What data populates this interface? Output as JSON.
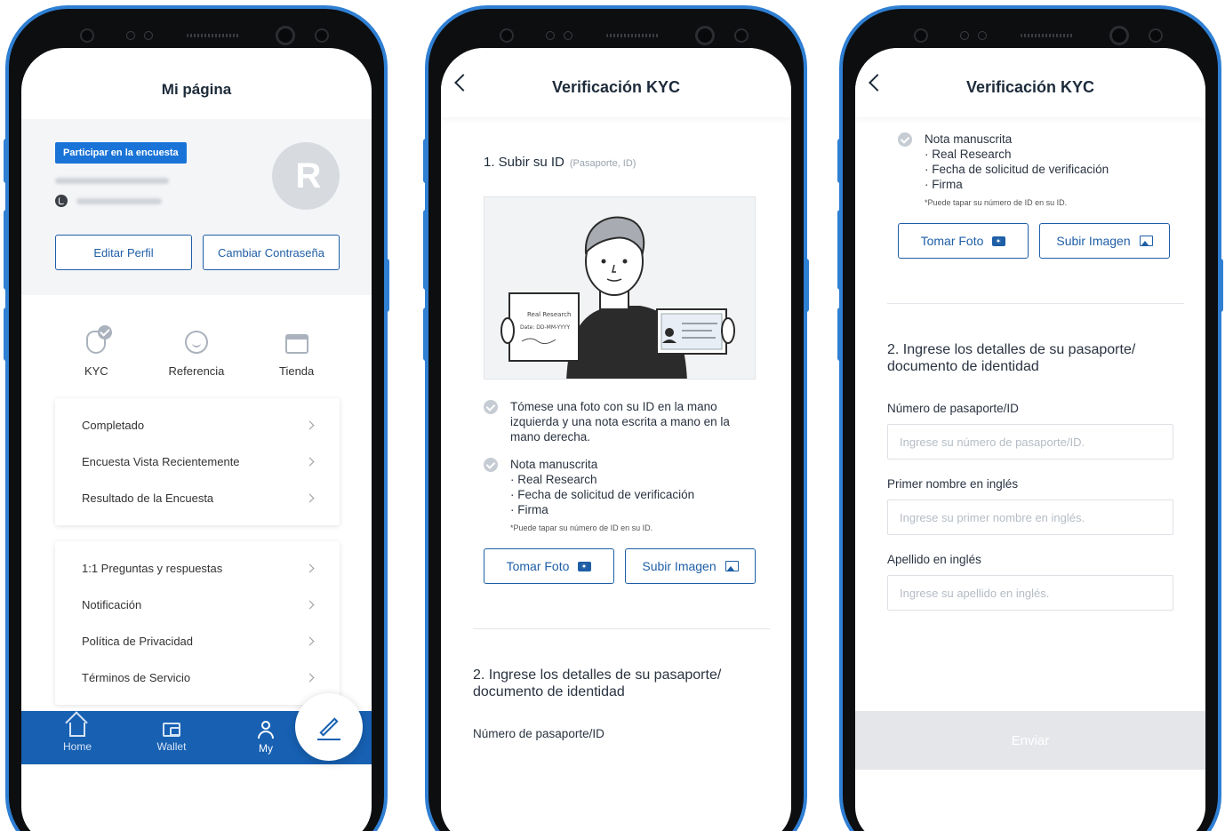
{
  "screen1": {
    "title": "Mi página",
    "survey_badge": "Participar en la encuesta",
    "avatar_text": "R",
    "edit_profile": "Editar Perfil",
    "change_password": "Cambiar Contraseña",
    "shortcuts": [
      {
        "label": "KYC",
        "icon": "shield-check-icon"
      },
      {
        "label": "Referencia",
        "icon": "smile-icon"
      },
      {
        "label": "Tienda",
        "icon": "store-icon"
      }
    ],
    "menu_group1": [
      "Completado",
      "Encuesta Vista Recientemente",
      "Resultado de la Encuesta"
    ],
    "menu_group2": [
      "1:1 Preguntas y respuestas",
      "Notificación",
      "Política de Privacidad",
      "Términos de Servicio"
    ],
    "tabs": [
      "Home",
      "Wallet",
      "My"
    ],
    "accent_color": "#1760b2"
  },
  "screen2": {
    "title": "Verificación KYC",
    "step1_title": "1. Subir su ID",
    "step1_sub": "(Pasaporte, ID)",
    "illus_note_line1": "Real Research",
    "illus_note_line2": "Date: DD-MM-YYYY",
    "bullet1": [
      "Tómese una foto con su ID en la mano",
      "izquierda y una nota escrita a mano en la",
      "mano derecha."
    ],
    "bullet2": [
      "Nota manuscrita",
      "· Real Research",
      "· Fecha de solicitud de verificación",
      "· Firma"
    ],
    "small_note": "*Puede tapar su número de ID en su ID.",
    "take_photo": "Tomar Foto",
    "upload_image": "Subir Imagen",
    "step2_title": [
      "2. Ingrese los detalles de su pasaporte/",
      "documento de identidad"
    ],
    "passport_label": "Número de pasaporte/ID"
  },
  "screen3": {
    "title": "Verificación KYC",
    "bullet2": [
      "Nota manuscrita",
      "· Real Research",
      "· Fecha de solicitud de verificación",
      "· Firma"
    ],
    "small_note": "*Puede tapar su número de ID en su ID.",
    "take_photo": "Tomar Foto",
    "upload_image": "Subir Imagen",
    "step2_title": [
      "2. Ingrese los detalles de su pasaporte/",
      "documento de identidad"
    ],
    "fields": [
      {
        "label": "Número de pasaporte/ID",
        "placeholder": "Ingrese su número de pasaporte/ID."
      },
      {
        "label": "Primer nombre en inglés",
        "placeholder": "Ingrese su primer nombre en inglés."
      },
      {
        "label": "Apellido en inglés",
        "placeholder": "Ingrese su apellido en inglés."
      }
    ],
    "submit": "Enviar"
  }
}
